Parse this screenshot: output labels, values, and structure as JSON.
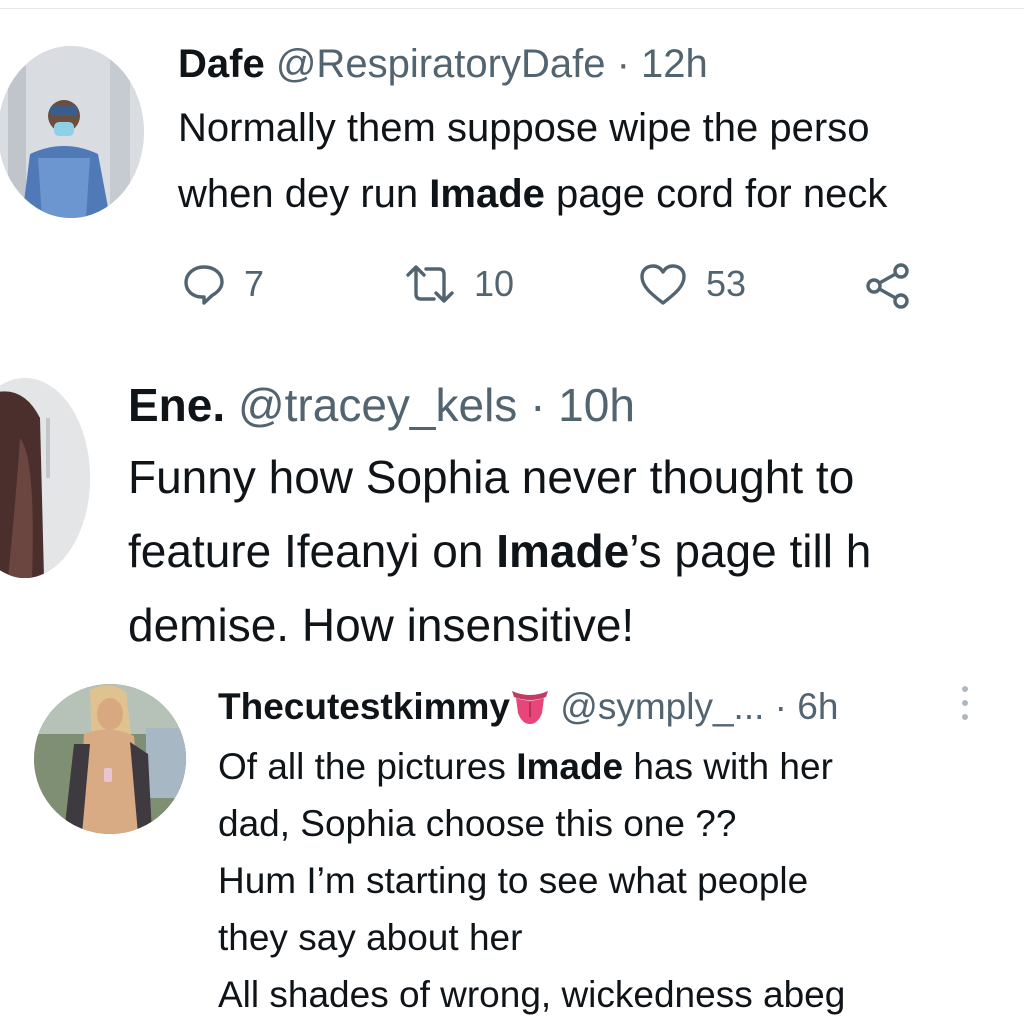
{
  "tweets": [
    {
      "name": "Dafe",
      "handle": "@RespiratoryDafe",
      "time": "· 12h",
      "lines": [
        {
          "before": "Normally them suppose wipe the perso",
          "bold": "",
          "after": ""
        },
        {
          "before": "when dey run ",
          "bold": "Imade",
          "after": " page cord for neck"
        }
      ],
      "actions": {
        "replies": "7",
        "retweets": "10",
        "likes": "53"
      }
    },
    {
      "name": "Ene.",
      "handle": "@tracey_kels",
      "time": "· 10h",
      "lines": [
        {
          "before": "Funny how Sophia never thought to",
          "bold": "",
          "after": ""
        },
        {
          "before": "feature Ifeanyi on ",
          "bold": "Imade",
          "after": "’s page till h"
        },
        {
          "before": "demise. How insensitive!",
          "bold": "",
          "after": ""
        }
      ]
    },
    {
      "name": "Thecutestkimmy",
      "handle": "@symply_...",
      "time": "· 6h",
      "lines": [
        {
          "before": "Of all the pictures ",
          "bold": "Imade",
          "after": " has with her"
        },
        {
          "before": "dad, Sophia choose this one ??",
          "bold": "",
          "after": ""
        },
        {
          "before": "Hum I’m starting to see what people",
          "bold": "",
          "after": ""
        },
        {
          "before": "they say about her",
          "bold": "",
          "after": ""
        },
        {
          "before": "All shades of wrong, wickedness abeg",
          "bold": "",
          "after": ""
        }
      ]
    }
  ],
  "icons": {
    "reply": "reply-icon",
    "retweet": "retweet-icon",
    "like": "heart-icon",
    "share": "share-icon",
    "more": "more-options-icon",
    "emoji": "tongue-emoji-icon"
  },
  "colors": {
    "text": "#0f1419",
    "secondary": "#536471",
    "emoji": "#e8457a"
  }
}
